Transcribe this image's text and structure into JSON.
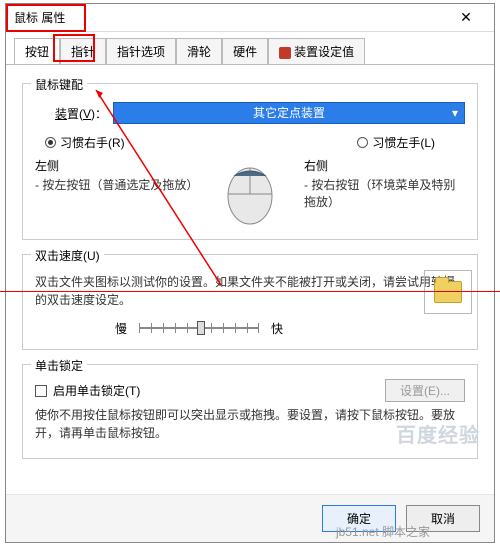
{
  "title": "鼠标 属性",
  "tabs": [
    "按钮",
    "指针",
    "指针选项",
    "滑轮",
    "硬件",
    "装置设定值"
  ],
  "group1": {
    "title": "鼠标键配",
    "deviceLabel": "装置(V)：",
    "deviceValue": "其它定点装置",
    "rightHand": "习惯右手(R)",
    "leftHand": "习惯左手(L)",
    "leftSide": "左侧",
    "leftDesc": "- 按左按钮（普通选定及拖放）",
    "rightSide": "右侧",
    "rightDesc": "- 按右按钮（环境菜单及特别拖放）"
  },
  "group2": {
    "title": "双击速度(U)",
    "desc": "双击文件夹图标以测试你的设置。如果文件夹不能被打开或关闭，请尝试用较慢的双击速度设定。",
    "slow": "慢",
    "fast": "快"
  },
  "group3": {
    "title": "单击锁定",
    "cbLabel": "启用单击锁定(T)",
    "settingsBtn": "设置(E)...",
    "desc": "使你不用按住鼠标按钮即可以突出显示或拖拽。要设置，请按下鼠标按钮。要放开，请再单击鼠标按钮。"
  },
  "footer": {
    "ok": "确定",
    "cancel": "取消"
  },
  "watermark": "百度经验",
  "wm2": "jb51.net 脚本之家"
}
